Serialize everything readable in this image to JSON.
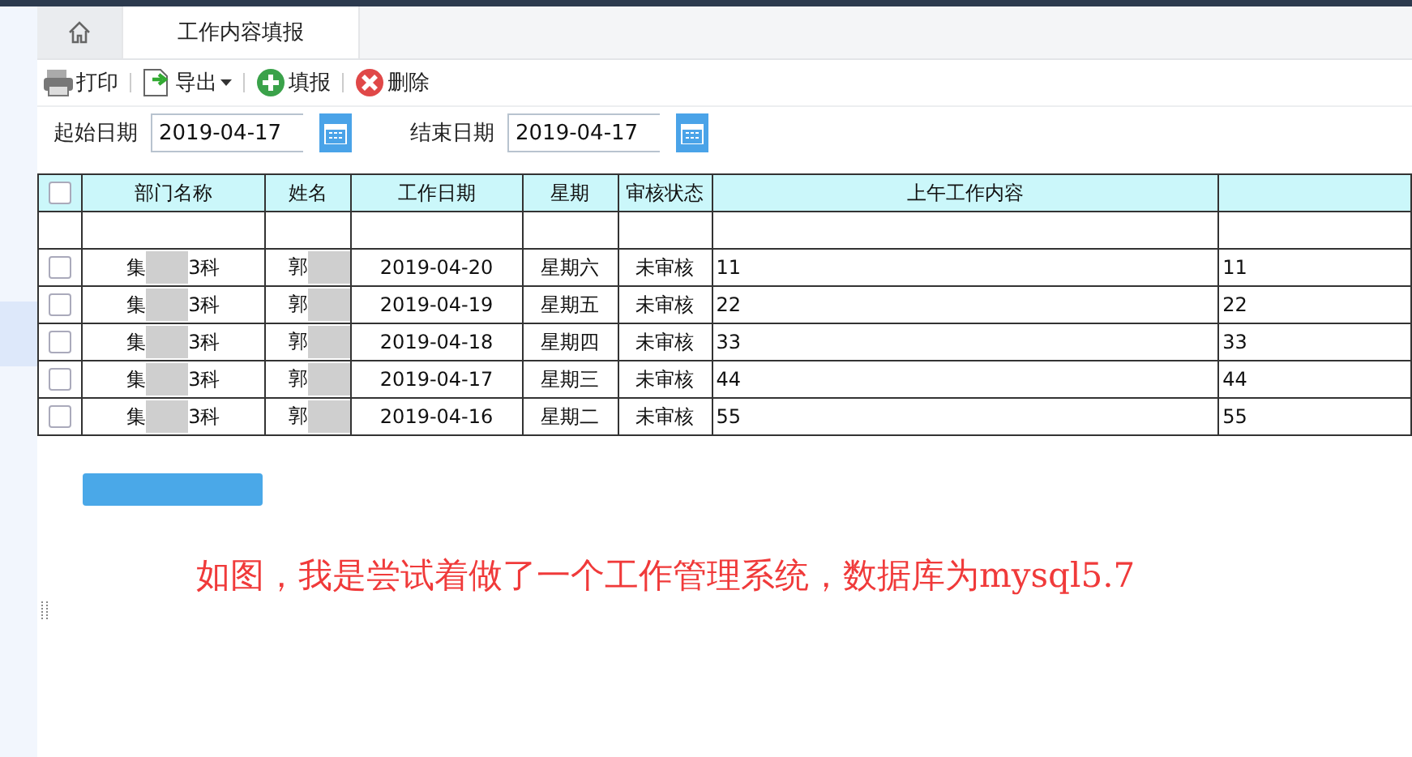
{
  "tabs": [
    {
      "kind": "home",
      "selected": false
    },
    {
      "kind": "page",
      "label": "工作内容填报",
      "selected": true
    }
  ],
  "toolbar": [
    {
      "kind": "print",
      "label": "打印"
    },
    {
      "kind": "export",
      "label": "导出",
      "dropdown": true
    },
    {
      "kind": "add",
      "label": "填报"
    },
    {
      "kind": "delete",
      "label": "删除"
    }
  ],
  "filters": [
    {
      "label": "起始日期",
      "value": "2019-04-17"
    },
    {
      "label": "结束日期",
      "value": "2019-04-17"
    }
  ],
  "table": {
    "header_checked": false,
    "columns": [
      "部门名称",
      "姓名",
      "工作日期",
      "星期",
      "审核状态",
      "上午工作内容",
      ""
    ],
    "rows": [
      {
        "checked": false,
        "department_start": "集",
        "department_end": "3科",
        "name": "郭",
        "date": "2019-04-20",
        "weekday": "星期六",
        "status": "未审核",
        "morning": "11",
        "column_8": "11"
      },
      {
        "checked": false,
        "department_start": "集",
        "department_end": "3科",
        "name": "郭",
        "date": "2019-04-19",
        "weekday": "星期五",
        "status": "未审核",
        "morning": "22",
        "column_8": "22"
      },
      {
        "checked": false,
        "department_start": "集",
        "department_end": "3科",
        "name": "郭",
        "date": "2019-04-18",
        "weekday": "星期四",
        "status": "未审核",
        "morning": "33",
        "column_8": "33"
      },
      {
        "checked": false,
        "department_start": "集",
        "department_end": "3科",
        "name": "郭",
        "date": "2019-04-17",
        "weekday": "星期三",
        "status": "未审核",
        "morning": "44",
        "column_8": "44"
      },
      {
        "checked": false,
        "department_start": "集",
        "department_end": "3科",
        "name": "郭",
        "date": "2019-04-16",
        "weekday": "星期二",
        "status": "未审核",
        "morning": "55",
        "column_8": "55"
      }
    ]
  },
  "note": "如图，我是尝试着做了一个工作管理系统，数据库为mysql5.7"
}
